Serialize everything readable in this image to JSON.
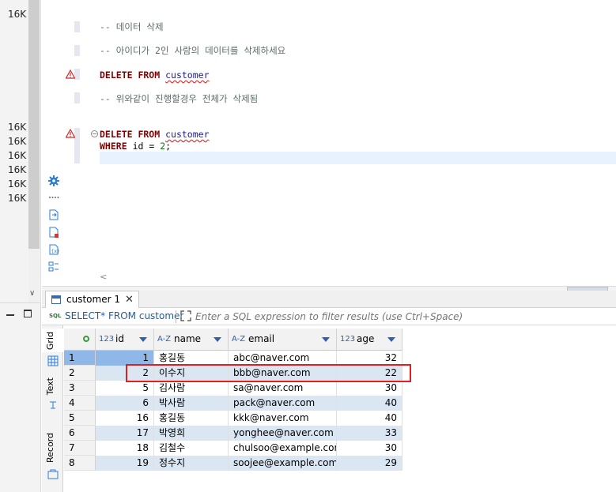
{
  "left_panel": {
    "size_labels": [
      "16K",
      "16K",
      "16K",
      "16K",
      "16K",
      "16K",
      "16K"
    ]
  },
  "editor": {
    "lines": [
      {
        "type": "comment",
        "text": "-- 데이터 삭제"
      },
      {
        "type": "comment",
        "text": "-- 아이디가 2인 사람의 데이터를 삭제하세요"
      },
      {
        "type": "delete",
        "kw": "DELETE FROM",
        "table": "customer"
      },
      {
        "type": "comment",
        "text": "-- 위와같이 진행할경우 전체가 삭제됨"
      },
      {
        "type": "delete",
        "kw": "DELETE FROM",
        "table": "customer"
      },
      {
        "type": "where",
        "kw": "WHERE",
        "col": "id",
        "op": "=",
        "val": "2",
        "end": ";"
      }
    ]
  },
  "results": {
    "tab_label": "customer 1",
    "tab_close": "✕",
    "sql_icon": "SQL",
    "sql_text": "SELECT* FROM customer",
    "filter_placeholder": "Enter a SQL expression to filter results (use Ctrl+Space)",
    "vtabs": {
      "grid": "Grid",
      "text": "Text",
      "record": "Record"
    },
    "columns": [
      {
        "type": "123",
        "name": "id"
      },
      {
        "type": "A-Z",
        "name": "name"
      },
      {
        "type": "A-Z",
        "name": "email"
      },
      {
        "type": "123",
        "name": "age"
      }
    ],
    "rows": [
      {
        "n": "1",
        "id": "1",
        "name": "홍길동",
        "email": "abc@naver.com",
        "age": "32"
      },
      {
        "n": "2",
        "id": "2",
        "name": "이수지",
        "email": "bbb@naver.com",
        "age": "22"
      },
      {
        "n": "3",
        "id": "5",
        "name": "김사람",
        "email": "sa@naver.com",
        "age": "30"
      },
      {
        "n": "4",
        "id": "6",
        "name": "박사람",
        "email": "pack@naver.com",
        "age": "40"
      },
      {
        "n": "5",
        "id": "16",
        "name": "홍길동",
        "email": "kkk@naver.com",
        "age": "40"
      },
      {
        "n": "6",
        "id": "17",
        "name": "박영희",
        "email": "yonghee@naver.com",
        "age": "33"
      },
      {
        "n": "7",
        "id": "18",
        "name": "김철수",
        "email": "chulsoo@example.com",
        "age": "30"
      },
      {
        "n": "8",
        "id": "19",
        "name": "정수지",
        "email": "soojee@example.com",
        "age": "29"
      }
    ]
  },
  "colors": {
    "keyword": "#7f0000",
    "highlight": "#e02020",
    "alt_row": "#dbe6f3",
    "selected": "#8fb8e8"
  }
}
